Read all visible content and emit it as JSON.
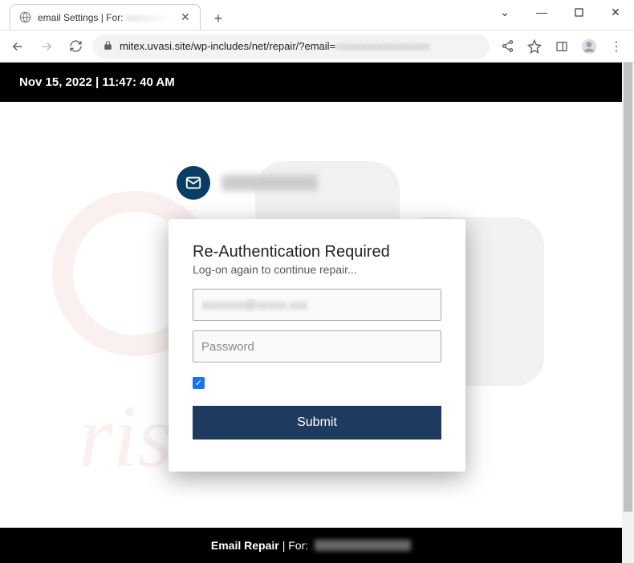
{
  "window": {
    "tab_title_prefix": "email Settings | For:",
    "minimize": "—",
    "maximize": "▢",
    "close": "✕"
  },
  "toolbar": {
    "url_visible": "mitex.uvasi.site/wp-includes/net/repair/?email="
  },
  "page": {
    "date_bar": "Nov 15, 2022 | 11:47: 40 AM"
  },
  "dialog": {
    "title": "Re-Authentication Required",
    "subtitle": "Log-on again to continue repair...",
    "password_placeholder": "Password",
    "submit_label": "Submit",
    "checkbox_checked": true
  },
  "footer": {
    "label_bold": "Email Repair",
    "label_rest": " | For: "
  },
  "icons": {
    "globe": "globe-icon",
    "tab_close": "✕",
    "new_tab": "+",
    "back": "←",
    "forward": "→",
    "reload": "⟳",
    "lock": "🔒",
    "share": "share-icon",
    "star": "☆",
    "panel": "▣",
    "profile": "profile-icon",
    "menu": "⋮",
    "chevron_down": "⌄",
    "check": "✓"
  }
}
